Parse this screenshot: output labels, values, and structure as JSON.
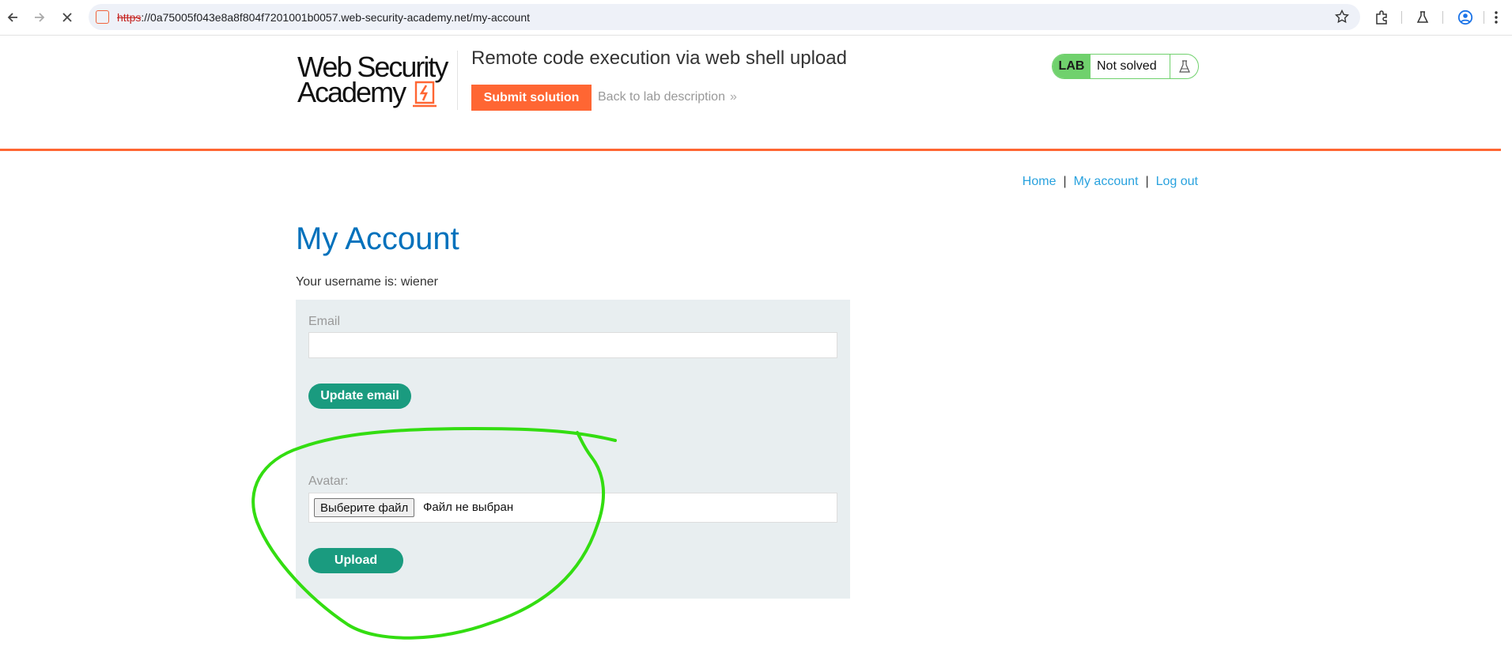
{
  "browser": {
    "url_protocol": "https",
    "url_rest": "://0a75005f043e8a8f804f7201001b0057.web-security-academy.net/my-account",
    "icons": [
      "back-arrow-icon",
      "forward-arrow-icon",
      "stop-loading-icon",
      "bookmark-star-icon",
      "extensions-icon",
      "labs-flask-icon",
      "profile-icon",
      "menu-dots-icon"
    ]
  },
  "header": {
    "logo_line1": "Web Security",
    "logo_line2": "Academy",
    "lab_title": "Remote code execution via web shell upload",
    "submit_label": "Submit solution",
    "back_label": "Back to lab description",
    "back_chevron": "»",
    "lab_tag": "LAB",
    "lab_status": "Not solved",
    "accent_color": "#ff6633",
    "status_color": "#70d16d"
  },
  "nav": {
    "home": "Home",
    "my_account": "My account",
    "log_out": "Log out",
    "separator": "|"
  },
  "main": {
    "title": "My Account",
    "username_text": "Your username is: wiener",
    "email_label": "Email",
    "email_value": "",
    "update_email_label": "Update email",
    "avatar_label": "Avatar:",
    "choose_file_label": "Выберите файл",
    "file_status": "Файл не выбран",
    "upload_label": "Upload",
    "button_color": "#1a9b7f",
    "title_color": "#0071bc"
  },
  "annotation": {
    "color": "#33dd11",
    "shape": "hand-drawn loop around avatar upload"
  }
}
